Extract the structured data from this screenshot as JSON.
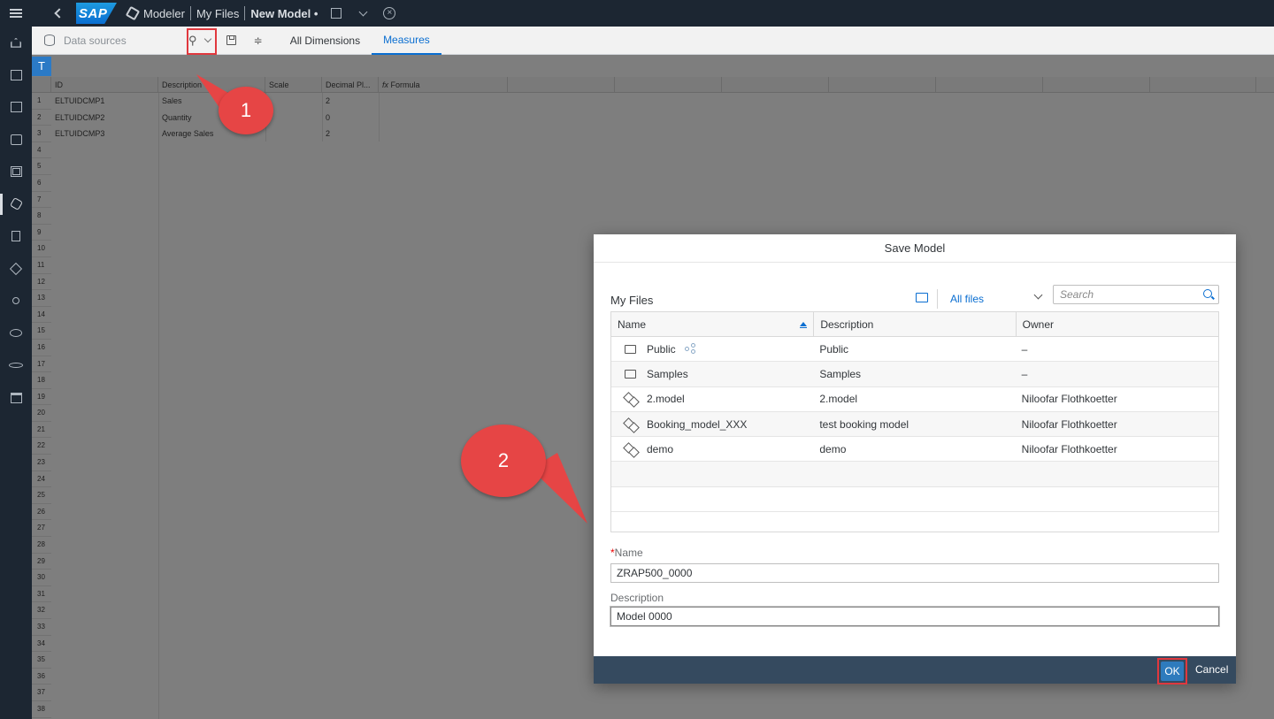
{
  "shell": {
    "logo": "SAP",
    "app": "Modeler",
    "breadcrumb": "My Files",
    "document": "New Model",
    "dirty_marker": "•"
  },
  "leftnav": {
    "items": [
      "home-icon",
      "files-icon",
      "stories-icon",
      "analytic-apps-icon",
      "datasets-icon",
      "modeler-icon",
      "data-import-icon",
      "connections-icon",
      "data-flow-icon",
      "search-to-insight-icon",
      "workflow-icon",
      "calendar-icon"
    ]
  },
  "toolbar": {
    "data_sources": "Data sources",
    "tabs": [
      "All Dimensions",
      "Measures"
    ],
    "active_tab": "Measures"
  },
  "grid": {
    "t_label": "T",
    "columns": [
      "ID",
      "Description",
      "Scale",
      "Decimal Pl...",
      "Formula"
    ],
    "formula_prefix": "fx",
    "rows": [
      {
        "id": "ELTUIDCMP1",
        "description": "Sales",
        "decimal": "2"
      },
      {
        "id": "ELTUIDCMP2",
        "description": "Quantity",
        "decimal": "0"
      },
      {
        "id": "ELTUIDCMP3",
        "description": "Average Sales",
        "decimal": "2"
      }
    ],
    "row_numbers": [
      "1",
      "2",
      "3",
      "4",
      "5",
      "6",
      "7",
      "8",
      "9",
      "10",
      "11",
      "12",
      "13",
      "14",
      "15",
      "16",
      "17",
      "18",
      "19",
      "20",
      "21",
      "22",
      "23",
      "24",
      "25",
      "26",
      "27",
      "28",
      "29",
      "30",
      "31",
      "32",
      "33",
      "34",
      "35",
      "36",
      "37",
      "38"
    ]
  },
  "callouts": {
    "one": "1",
    "two": "2",
    "color": "#e64545"
  },
  "dialog": {
    "title": "Save Model",
    "location": "My Files",
    "filter": "All files",
    "search_placeholder": "Search",
    "columns": {
      "name": "Name",
      "description": "Description",
      "owner": "Owner"
    },
    "files": [
      {
        "type": "folder",
        "name": "Public",
        "description": "Public",
        "owner": "–",
        "shared": true
      },
      {
        "type": "folder",
        "name": "Samples",
        "description": "Samples",
        "owner": "–"
      },
      {
        "type": "model",
        "name": "2.model",
        "description": "2.model",
        "owner": "Niloofar Flothkoetter"
      },
      {
        "type": "model",
        "name": "Booking_model_XXX",
        "description": "test booking model",
        "owner": "Niloofar Flothkoetter"
      },
      {
        "type": "model",
        "name": "demo",
        "description": "demo",
        "owner": "Niloofar Flothkoetter"
      }
    ],
    "name_label": "Name",
    "name_required_marker": "*",
    "name_value": "ZRAP500_0000",
    "description_label": "Description",
    "description_value": "Model 0000",
    "ok": "OK",
    "cancel": "Cancel"
  },
  "colors": {
    "shell_bg": "#1c2632",
    "accent": "#0a6ed1",
    "footer_bg": "#354a5f",
    "highlight_border": "#e0383e"
  }
}
